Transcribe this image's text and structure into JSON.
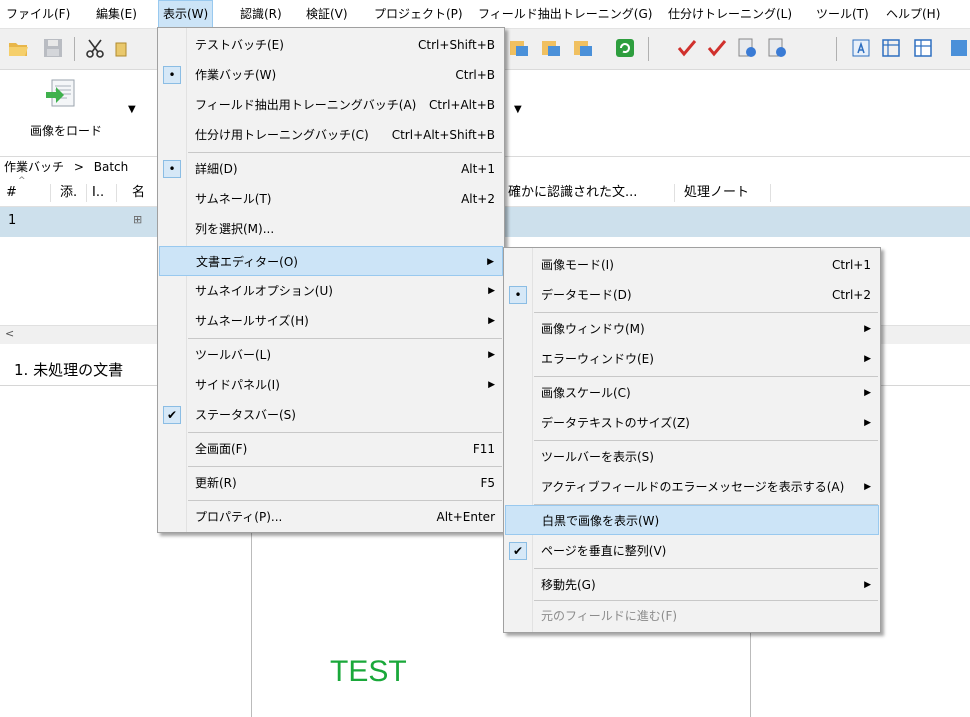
{
  "menubar": [
    "ファイル(F)",
    "編集(E)",
    "表示(W)",
    "認識(R)",
    "検証(V)",
    "プロジェクト(P)",
    "フィールド抽出トレーニング(G)",
    "仕分けトレーニング(L)",
    "ツール(T)",
    "ヘルプ(H)"
  ],
  "ribbon": {
    "load_image": "画像をロード"
  },
  "breadcrumb": {
    "root": "作業バッチ",
    "sep": ">",
    "current": "Batch"
  },
  "list": {
    "headers": [
      "#",
      "添.",
      "I..",
      "名",
      "確かに認識された文...",
      "処理ノート"
    ],
    "row_number": "1"
  },
  "tabs": {
    "unprocessed": "1. 未処理の文書"
  },
  "document": {
    "text": "TEST"
  },
  "view_menu": [
    {
      "label": "テストバッチ(E)",
      "shortcut": "Ctrl+Shift+B"
    },
    {
      "label": "作業バッチ(W)",
      "shortcut": "Ctrl+B",
      "mark": "•"
    },
    {
      "label": "フィールド抽出用トレーニングバッチ(A)",
      "shortcut": "Ctrl+Alt+B"
    },
    {
      "label": "仕分け用トレーニングバッチ(C)",
      "shortcut": "Ctrl+Alt+Shift+B"
    },
    {
      "label": "詳細(D)",
      "shortcut": "Alt+1",
      "mark": "•"
    },
    {
      "label": "サムネール(T)",
      "shortcut": "Alt+2"
    },
    {
      "label": "列を選択(M)..."
    },
    {
      "label": "文書エディター(O)",
      "submenu": "▶"
    },
    {
      "label": "サムネイルオプション(U)",
      "submenu": "▶"
    },
    {
      "label": "サムネールサイズ(H)",
      "submenu": "▶"
    },
    {
      "label": "ツールバー(L)",
      "submenu": "▶"
    },
    {
      "label": "サイドパネル(I)",
      "submenu": "▶"
    },
    {
      "label": "ステータスバー(S)",
      "mark": "✔"
    },
    {
      "label": "全画面(F)",
      "shortcut": "F11"
    },
    {
      "label": "更新(R)",
      "shortcut": "F5"
    },
    {
      "label": "プロパティ(P)...",
      "shortcut": "Alt+Enter"
    }
  ],
  "doc_editor_menu": [
    {
      "label": "画像モード(I)",
      "shortcut": "Ctrl+1"
    },
    {
      "label": "データモード(D)",
      "shortcut": "Ctrl+2",
      "mark": "•"
    },
    {
      "label": "画像ウィンドウ(M)",
      "submenu": "▶"
    },
    {
      "label": "エラーウィンドウ(E)",
      "submenu": "▶"
    },
    {
      "label": "画像スケール(C)",
      "submenu": "▶"
    },
    {
      "label": "データテキストのサイズ(Z)",
      "submenu": "▶"
    },
    {
      "label": "ツールバーを表示(S)"
    },
    {
      "label": "アクティブフィールドのエラーメッセージを表示する(A)",
      "submenu": "▶"
    },
    {
      "label": "白黒で画像を表示(W)"
    },
    {
      "label": "ページを垂直に整列(V)",
      "mark": "✔"
    },
    {
      "label": "移動先(G)",
      "submenu": "▶"
    },
    {
      "label": "元のフィールドに進む(F)"
    }
  ],
  "colors": {
    "highlight": "#cce4f7",
    "highlight_border": "#99c9ef",
    "selected_row": "#cde0ec",
    "test_text": "#1aa83a"
  }
}
